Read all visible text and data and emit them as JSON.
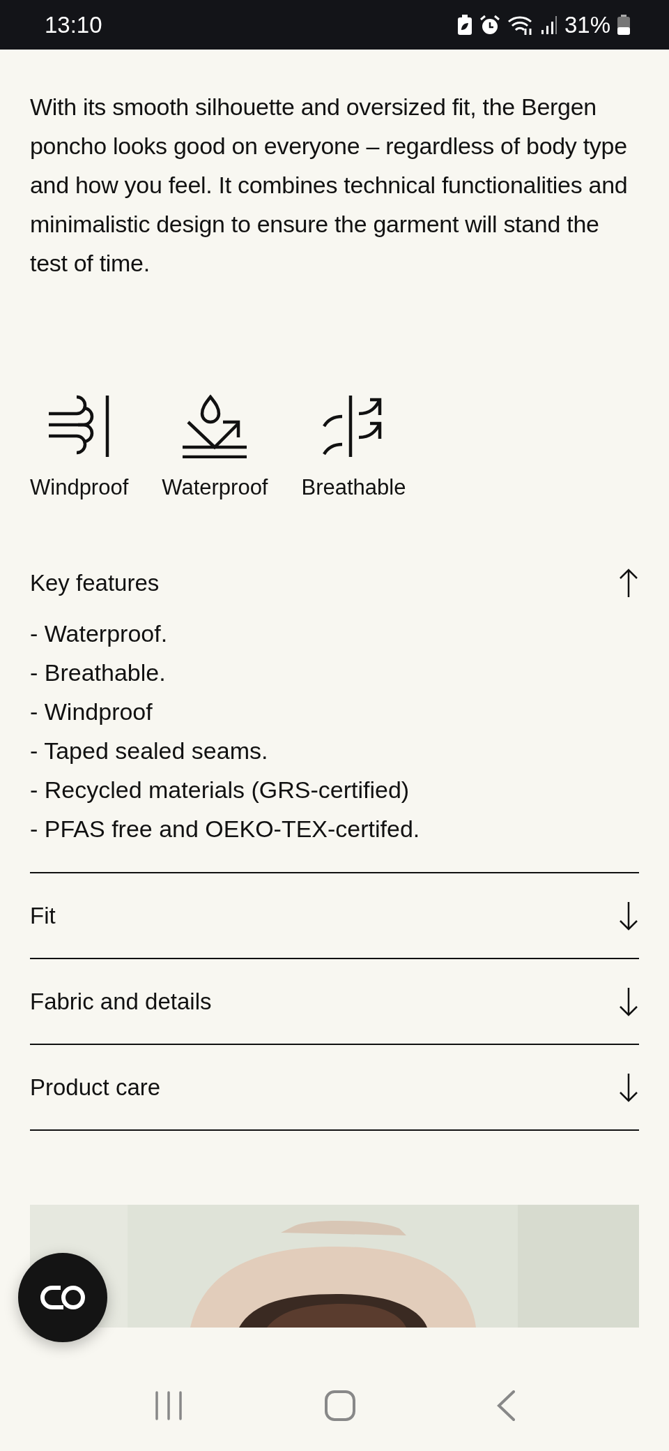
{
  "status_bar": {
    "time": "13:10",
    "battery": "31%"
  },
  "description": "With its smooth silhouette and oversized fit, the Bergen poncho looks good on everyone – regardless of body type and how you feel. It combines technical functionalities and minimalistic design to ensure the garment will stand the test of time.",
  "properties": [
    {
      "kind": "wind",
      "label": "Windproof"
    },
    {
      "kind": "water",
      "label": "Waterproof"
    },
    {
      "kind": "breathable",
      "label": "Breathable"
    }
  ],
  "sections": [
    {
      "title": "Key features",
      "expanded": true,
      "items": [
        "- Waterproof.",
        "- Breathable.",
        "- Windproof",
        "- Taped sealed seams.",
        "- Recycled materials (GRS-certified)",
        "- PFAS free and OEKO-TEX-certifed."
      ]
    },
    {
      "title": "Fit",
      "expanded": false
    },
    {
      "title": "Fabric and details",
      "expanded": false
    },
    {
      "title": "Product care",
      "expanded": false
    }
  ]
}
